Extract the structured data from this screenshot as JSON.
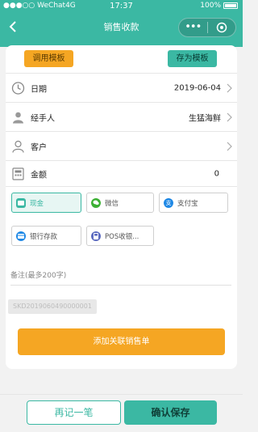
{
  "status_bar": {
    "carrier": "WeChat4G",
    "time": "17:37",
    "battery": "100%"
  },
  "nav": {
    "title": "销售收款",
    "more_icon": "more-dots-icon",
    "target_icon": "target-icon"
  },
  "template": {
    "load_label": "调用模板",
    "save_label": "存为模板"
  },
  "form": {
    "date": {
      "label": "日期",
      "value": "2019-06-04",
      "icon": "clock-icon"
    },
    "handler": {
      "label": "经手人",
      "value": "生猛海鲜",
      "icon": "person-icon"
    },
    "customer": {
      "label": "客户",
      "value": "",
      "icon": "user-outline-icon"
    },
    "amount": {
      "label": "金额",
      "value": "0",
      "icon": "calculator-icon"
    }
  },
  "payment_methods": [
    {
      "label": "现金",
      "icon": "cash-icon",
      "color": "#3bb8a3",
      "selected": true
    },
    {
      "label": "微信",
      "icon": "wechat-icon",
      "color": "#3cb034",
      "selected": false
    },
    {
      "label": "支付宝",
      "icon": "alipay-icon",
      "color": "#1e88e5",
      "selected": false
    },
    {
      "label": "银行存款",
      "icon": "bank-icon",
      "color": "#1e88e5",
      "selected": false
    },
    {
      "label": "POS收银...",
      "icon": "pos-icon",
      "color": "#5c6bc0",
      "selected": false
    }
  ],
  "remark": {
    "placeholder": "备注(最多200字)"
  },
  "document_no": "SKD2019060490000001",
  "link_button": "添加关联销售单",
  "footer": {
    "again_label": "再记一笔",
    "confirm_label": "确认保存"
  },
  "colors": {
    "primary": "#3bb8a3",
    "accent": "#f5a623"
  }
}
